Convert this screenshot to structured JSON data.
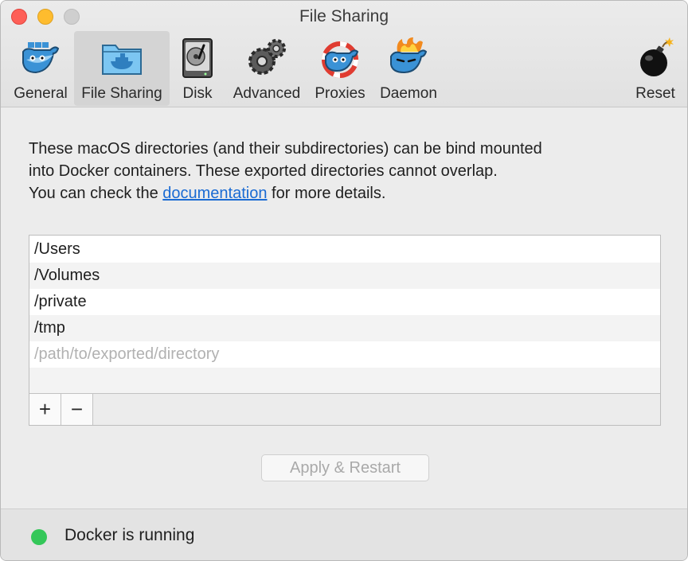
{
  "window": {
    "title": "File Sharing"
  },
  "toolbar": {
    "items": [
      {
        "label": "General",
        "icon": "docker-whale-icon",
        "selected": false
      },
      {
        "label": "File Sharing",
        "icon": "folder-whale-icon",
        "selected": true
      },
      {
        "label": "Disk",
        "icon": "hard-disk-icon",
        "selected": false
      },
      {
        "label": "Advanced",
        "icon": "gears-icon",
        "selected": false
      },
      {
        "label": "Proxies",
        "icon": "whale-lifebuoy-icon",
        "selected": false
      },
      {
        "label": "Daemon",
        "icon": "whale-fire-icon",
        "selected": false
      }
    ],
    "reset": {
      "label": "Reset",
      "icon": "bomb-icon"
    }
  },
  "description": {
    "line1": "These macOS directories (and their subdirectories) can be bind mounted",
    "line2": "into Docker containers. These exported directories cannot overlap.",
    "line3_before": "You can check the ",
    "link": "documentation",
    "line3_after": " for more details."
  },
  "directories": {
    "items": [
      "/Users",
      "/Volumes",
      "/private",
      "/tmp"
    ],
    "placeholder": "/path/to/exported/directory",
    "add_label": "+",
    "remove_label": "−"
  },
  "apply_button": {
    "label": "Apply & Restart",
    "enabled": false
  },
  "status": {
    "text": "Docker is running",
    "color": "#34c759"
  }
}
